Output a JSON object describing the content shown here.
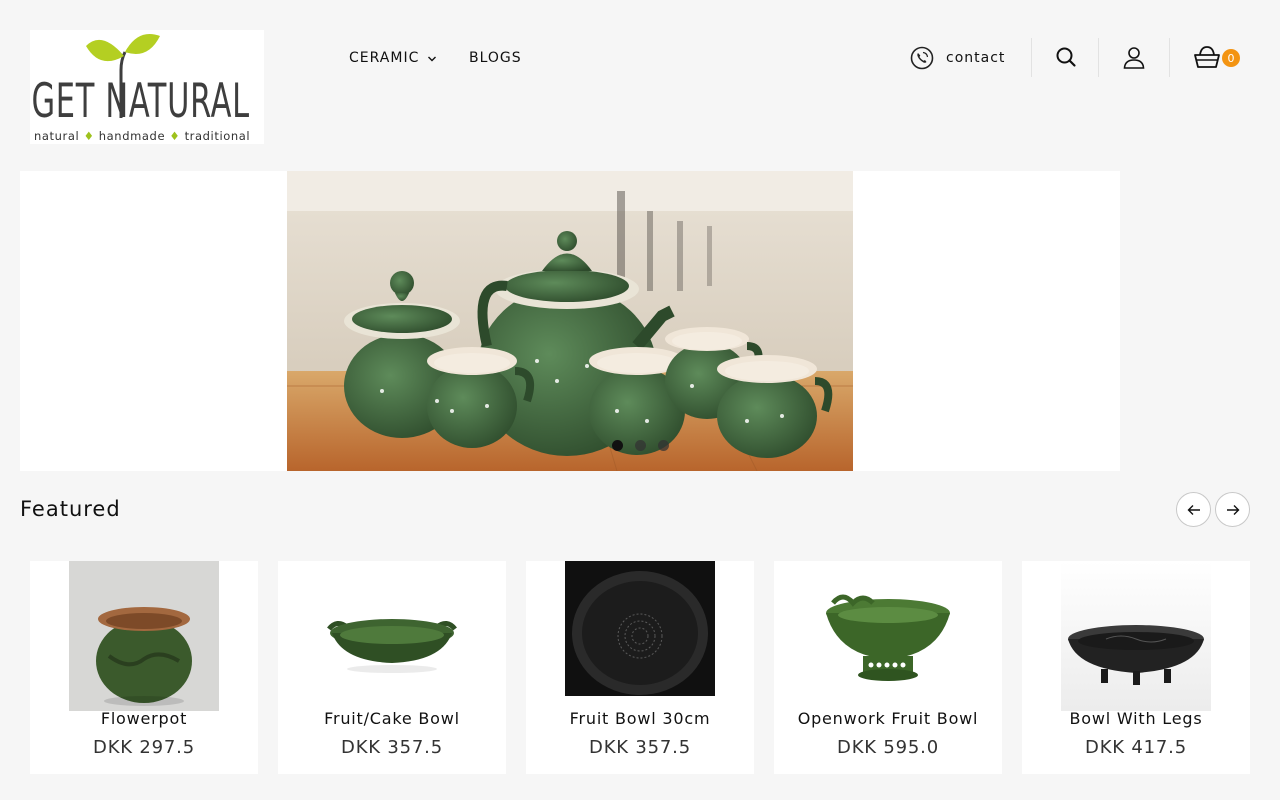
{
  "brand": {
    "logo_main": "GET NATURAL",
    "logo_tagline": [
      "natural",
      "handmade",
      "traditional"
    ],
    "accent": "#9ec21d"
  },
  "nav": {
    "items": [
      {
        "label": "CERAMIC",
        "has_dropdown": true
      },
      {
        "label": "BLOGS",
        "has_dropdown": false
      }
    ]
  },
  "header": {
    "contact_label": "contact",
    "contact_icon": "phone-icon",
    "search_icon": "search-icon",
    "account_icon": "user-icon",
    "cart_icon": "basket-icon",
    "cart_count": "0",
    "badge_color": "#f39412"
  },
  "hero": {
    "slides_count": 3,
    "active_slide": 1
  },
  "featured": {
    "title": "Featured",
    "prev_icon": "arrow-left-icon",
    "next_icon": "arrow-right-icon",
    "products": [
      {
        "name": "Flowerpot",
        "price": "DKK 297.5"
      },
      {
        "name": "Fruit/Cake Bowl",
        "price": "DKK 357.5"
      },
      {
        "name": "Fruit Bowl 30cm",
        "price": "DKK 357.5"
      },
      {
        "name": "Openwork Fruit Bowl",
        "price": "DKK 595.0"
      },
      {
        "name": "Bowl With Legs",
        "price": "DKK 417.5"
      }
    ]
  }
}
